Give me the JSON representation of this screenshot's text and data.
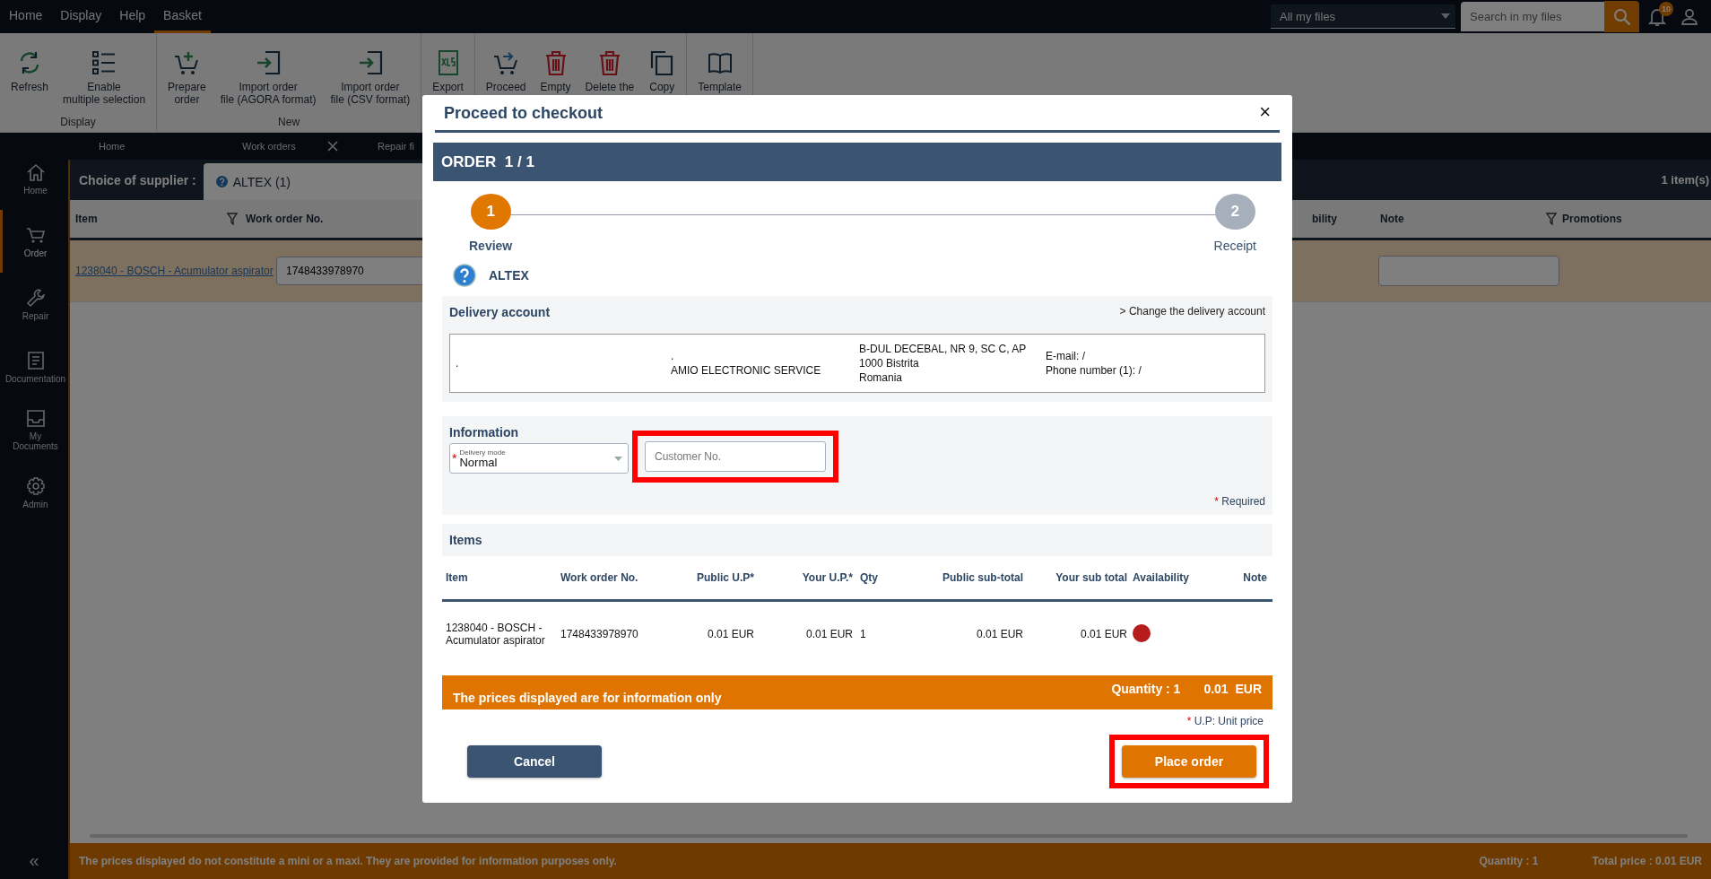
{
  "menu": [
    {
      "label": "Home",
      "selected": false
    },
    {
      "label": "Display",
      "selected": false
    },
    {
      "label": "Help",
      "selected": false
    },
    {
      "label": "Basket",
      "selected": true
    }
  ],
  "file_scope": {
    "value": "All my files"
  },
  "search": {
    "placeholder": "Search in my files"
  },
  "notifications": {
    "count": "10"
  },
  "ribbon": [
    {
      "group": "Display",
      "buttons": [
        "Refresh",
        "Enable\nmultiple selection"
      ]
    },
    {
      "group": "New",
      "buttons": [
        "Prepare\norder",
        "Import order\nfile (AGORA format)",
        "Import order\nfile (CSV format)"
      ]
    },
    {
      "buttons": [
        "Export"
      ]
    },
    {
      "buttons": [
        "Proceed",
        "Empty",
        "Delete the",
        "Copy"
      ]
    },
    {
      "buttons": [
        "Template"
      ]
    }
  ],
  "sidebar": {
    "items": [
      {
        "label": "Home",
        "selected": false
      },
      {
        "label": "Order",
        "selected": true
      },
      {
        "label": "Repair",
        "selected": false
      },
      {
        "label": "Documentation",
        "selected": false
      },
      {
        "label": "My Documents",
        "selected": false
      },
      {
        "label": "Admin",
        "selected": false
      }
    ],
    "collapse": "«"
  },
  "page_tabs": [
    {
      "label": "Home",
      "closable": false
    },
    {
      "label": "Work orders",
      "closable": true
    },
    {
      "label": "Repair fi",
      "closable": false
    }
  ],
  "supplier_bar": {
    "label": "Choice of supplier :",
    "supplier_tab": "ALTEX (1)",
    "count": "1 item(s)"
  },
  "basket_table": {
    "columns": [
      "Item",
      "Work order No.",
      "bility",
      "Note",
      "Promotions"
    ],
    "rows": [
      {
        "item": "1238040 - BOSCH - Acumulator aspirator",
        "work_order": "1748433978970"
      }
    ]
  },
  "footer": {
    "notice": "The prices displayed do not constitute a mini or a maxi. They are provided for information purposes only.",
    "quantity": "Quantity : 1",
    "total": "Total price : 0.01  EUR"
  },
  "dialog": {
    "title": "Proceed to checkout",
    "close": "×",
    "order_heading": "ORDER  1 / 1",
    "steps": [
      {
        "number": "1",
        "label": "Review",
        "selected": true
      },
      {
        "number": "2",
        "label": "Receipt",
        "selected": false
      }
    ],
    "supplier": "ALTEX",
    "delivery": {
      "heading": "Delivery account",
      "change_link": "> Change the delivery account",
      "columns": [
        [
          "."
        ],
        [
          ".",
          "AMIO ELECTRONIC SERVICE"
        ],
        [
          "B-DUL DECEBAL, NR 9, SC C, AP",
          "1000 Bistrita",
          "Romania"
        ],
        [
          "E-mail: /",
          "Phone number (1): /"
        ]
      ]
    },
    "information": {
      "heading": "Information",
      "delivery_mode": {
        "label": "Delivery mode",
        "value": "Normal",
        "required_mark": "*"
      },
      "customer_no": {
        "placeholder": "Customer No.",
        "highlighted": true
      },
      "required_mark": "*",
      "required_note": "Required"
    },
    "items": {
      "heading": "Items",
      "columns": [
        "Item",
        "Work order No.",
        "Public U.P*",
        "Your U.P.*",
        "Qty",
        "Public sub-total",
        "Your sub total",
        "Availability",
        "Note"
      ],
      "rows": [
        {
          "item": "1238040 - BOSCH - Acumulator aspirator",
          "work_order": "1748433978970",
          "public_up": "0.01 EUR",
          "your_up": "0.01 EUR",
          "qty": "1",
          "public_subtotal": "0.01 EUR",
          "your_subtotal": "0.01 EUR",
          "color": "#b71c1c"
        }
      ],
      "summary": {
        "notice": "The prices displayed are for information only",
        "quantity": "Quantity : 1",
        "total": "0.01  EUR"
      },
      "unit_mark": "*",
      "unit_note": "U.P: Unit price"
    },
    "buttons": [
      {
        "label": "Cancel",
        "kind": "secondary",
        "highlighted": false
      },
      {
        "label": "Place order",
        "kind": "primary",
        "highlighted": true
      }
    ]
  }
}
